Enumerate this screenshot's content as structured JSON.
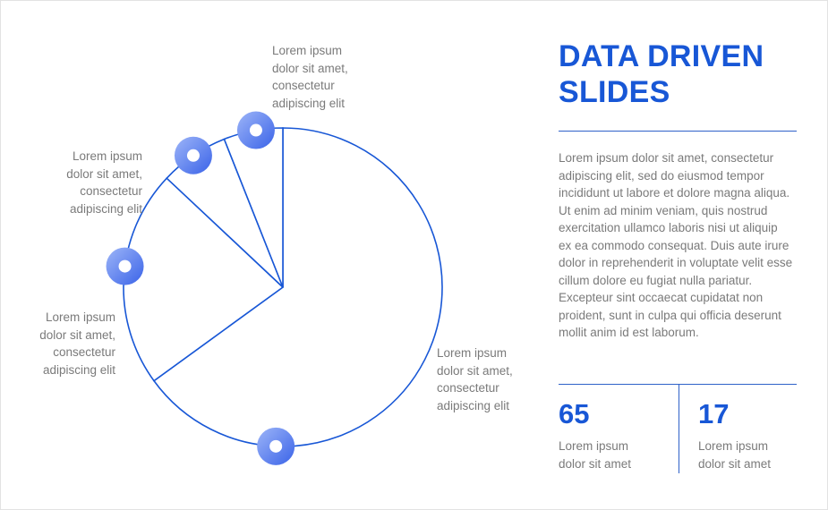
{
  "chart_data": {
    "type": "pie",
    "slices": [
      {
        "value": 65
      },
      {
        "value": 22
      },
      {
        "value": 7
      },
      {
        "value": 6
      }
    ],
    "colors": {
      "outline": "#1857d6",
      "marker_light": "#9db5f8",
      "marker_dark": "#3a63e8"
    }
  },
  "callouts": {
    "top": "Lorem ipsum\ndolor sit amet,\nconsectetur\nadipiscing elit",
    "upper_left": "Lorem ipsum\ndolor sit amet,\nconsectetur\nadipiscing elit",
    "lower_left": "Lorem ipsum\ndolor sit amet,\nconsectetur\nadipiscing elit",
    "right": "Lorem ipsum\ndolor sit amet,\nconsectetur\nadipiscing elit"
  },
  "title": "DATA DRIVEN\nSLIDES",
  "body": "Lorem ipsum dolor sit amet, consectetur adipiscing elit, sed do eiusmod tempor incididunt ut labore et dolore magna aliqua. Ut enim ad minim veniam, quis nostrud exercitation ullamco laboris nisi ut aliquip ex ea commodo consequat. Duis aute irure dolor in reprehenderit in voluptate velit esse cillum dolore eu fugiat nulla pariatur. Excepteur sint occaecat cupidatat non proident, sunt in culpa qui officia deserunt mollit anim id est laborum.",
  "stats": [
    {
      "value": "65",
      "label": "Lorem ipsum\ndolor sit amet"
    },
    {
      "value": "17",
      "label": "Lorem ipsum\ndolor sit amet"
    }
  ]
}
